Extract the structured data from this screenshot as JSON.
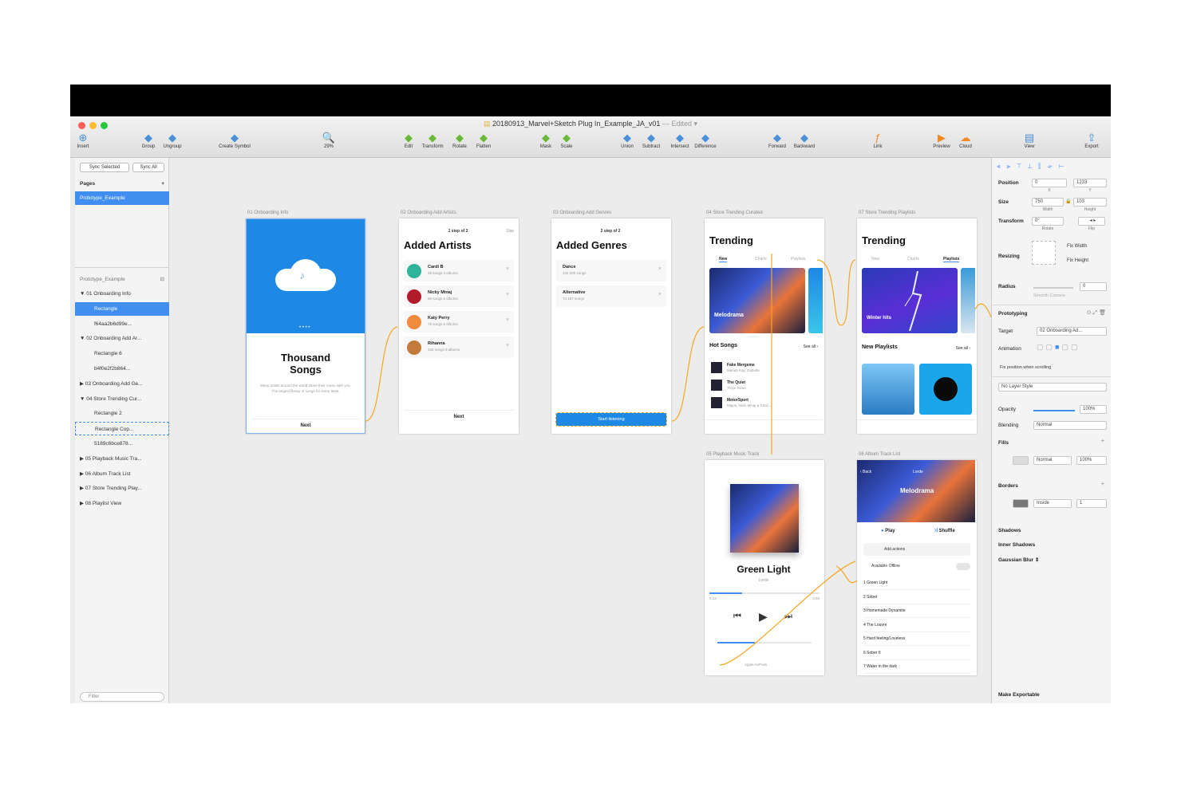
{
  "window": {
    "title": "20180913_Marvel+Sketch Plug In_Example_JA_v01",
    "edited": "— Edited ▾"
  },
  "toolbar": {
    "items": [
      {
        "label": "Insert",
        "icon": "plus-icon"
      },
      {
        "label": "Group",
        "icon": "group-icon"
      },
      {
        "label": "Ungroup",
        "icon": "ungroup-icon"
      },
      {
        "label": "Create Symbol",
        "icon": "symbol-icon"
      },
      {
        "label": "29%",
        "icon": "zoom-icon"
      },
      {
        "label": "Edit",
        "icon": "edit-icon"
      },
      {
        "label": "Transform",
        "icon": "transform-icon"
      },
      {
        "label": "Rotate",
        "icon": "rotate-icon"
      },
      {
        "label": "Flatten",
        "icon": "flatten-icon"
      },
      {
        "label": "Mask",
        "icon": "mask-icon"
      },
      {
        "label": "Scale",
        "icon": "scale-icon"
      },
      {
        "label": "Union",
        "icon": "union-icon"
      },
      {
        "label": "Subtract",
        "icon": "subtract-icon"
      },
      {
        "label": "Intersect",
        "icon": "intersect-icon"
      },
      {
        "label": "Difference",
        "icon": "difference-icon"
      },
      {
        "label": "Forward",
        "icon": "forward-icon"
      },
      {
        "label": "Backward",
        "icon": "backward-icon"
      },
      {
        "label": "Link",
        "icon": "link-icon"
      },
      {
        "label": "Preview",
        "icon": "preview-icon"
      },
      {
        "label": "Cloud",
        "icon": "cloud-icon"
      },
      {
        "label": "View",
        "icon": "view-icon"
      },
      {
        "label": "Export",
        "icon": "export-icon"
      }
    ]
  },
  "left": {
    "sync_selected": "Sync Selected",
    "sync_all": "Sync All",
    "pages_label": "Pages",
    "page_selected": "Prototype_Example",
    "layers_header": "Prototype_Example",
    "layers": [
      {
        "label": "▼ 01 Onboarding Info",
        "state": ""
      },
      {
        "label": "Rectangle",
        "state": "sel",
        "indent": 1
      },
      {
        "label": "f64aa2b6d99e...",
        "state": "",
        "indent": 1
      },
      {
        "label": "▼ 02 Onboarding Add Ar...",
        "state": ""
      },
      {
        "label": "Rectangle 6",
        "state": "",
        "indent": 1
      },
      {
        "label": "b4f0e2f2b864...",
        "state": "",
        "indent": 1
      },
      {
        "label": "▶ 03 Onboarding Add Ge...",
        "state": ""
      },
      {
        "label": "▼ 04 Store Trending Cur...",
        "state": ""
      },
      {
        "label": "Rectangle 2",
        "state": "",
        "indent": 1
      },
      {
        "label": "Rectangle Cop...",
        "state": "hl",
        "indent": 1
      },
      {
        "label": "5189c6bce878...",
        "state": "",
        "indent": 1
      },
      {
        "label": "▶ 05 Playback Music Tra...",
        "state": ""
      },
      {
        "label": "▶ 06 Album Track List",
        "state": ""
      },
      {
        "label": "▶ 07 Store Trending Play...",
        "state": ""
      },
      {
        "label": "▶ 08 Playlist View",
        "state": ""
      }
    ],
    "filter": "Filter"
  },
  "right": {
    "position_label": "Position",
    "x": "0",
    "y": "1233",
    "x_label": "X",
    "y_label": "Y",
    "size_label": "Size",
    "w": "750",
    "h": "103",
    "w_label": "Width",
    "h_label": "Height",
    "transform_label": "Transform",
    "rotate": "0°",
    "rotate_label": "Rotate",
    "flip_label": "Flip",
    "resizing_label": "Resizing",
    "fix_width": "Fix Width",
    "fix_height": "Fix Height",
    "radius_label": "Radius",
    "radius": "0",
    "smooth": "Smooth Corners",
    "prototyping_label": "Prototyping",
    "target_label": "Target",
    "target": "02 Onboarding Ad...",
    "animation_label": "Animation",
    "fix_scroll": "Fix position when scrolling",
    "layer_style": "No Layer Style",
    "opacity_label": "Opacity",
    "opacity": "100%",
    "opacity_value": 1.0,
    "blending_label": "Blending",
    "blending": "Normal",
    "fills_label": "Fills",
    "fill_blend": "Normal",
    "fill_opacity": "100%",
    "fill_sub": [
      "Fill",
      "Blending",
      "Opacity"
    ],
    "borders_label": "Borders",
    "border_pos": "Inside",
    "border_thick": "1",
    "border_sub": [
      "Color",
      "Position",
      "Thickness"
    ],
    "shadows": "Shadows",
    "inner_shadows": "Inner Shadows",
    "gaussian": "Gaussian Blur ⇕",
    "exportable": "Make Exportable"
  },
  "artboards": {
    "a1": {
      "label": "01 Onboarding Info",
      "title": "Thousand Songs",
      "body": "Many artists around the world share their music with you. The largest library of songs for every taste.",
      "btn": "Next"
    },
    "a2": {
      "label": "02 Onboarding Add Artists",
      "step": "1 step of 2",
      "skip": "Skip",
      "title": "Added Artists",
      "btn": "Next",
      "items": [
        {
          "name": "Cardi B",
          "sub": "38 songs 3 albums",
          "color": "#2fb39a"
        },
        {
          "name": "Nicky Minaj",
          "sub": "88 songs 6 albums",
          "color": "#b21c2a"
        },
        {
          "name": "Katy Perry",
          "sub": "75 songs 6 albums",
          "color": "#f08a3c"
        },
        {
          "name": "Rihanna",
          "sub": "102 songs 8 albums",
          "color": "#c47a3a"
        }
      ]
    },
    "a3": {
      "label": "03 Onboarding Add Genres",
      "step": "2 step of 2",
      "title": "Added Genres",
      "btn": "Start listening",
      "items": [
        {
          "name": "Dance",
          "sub": "344 000 songs"
        },
        {
          "name": "Alternative",
          "sub": "74 187 songs"
        }
      ]
    },
    "a4": {
      "label": "04 Store Trending Curated",
      "title": "Trending",
      "tabs": [
        "New",
        "Charts",
        "Playlists"
      ],
      "card_title": "Melodrama",
      "section": "Hot Songs",
      "see_all": "See all ›",
      "songs": [
        {
          "name": "Fake Mergeme",
          "sub": "Mariah Kay, Gabutte"
        },
        {
          "name": "The Quiet",
          "sub": "Troye Sivan"
        },
        {
          "name": "MotorSport",
          "sub": "Migos, Nicki Minaj & Card..."
        }
      ]
    },
    "a5": {
      "label": "07 Store Trending Playlists",
      "title": "Trending",
      "tabs": [
        "New",
        "Charts",
        "Playlists"
      ],
      "card_title": "Winter hits",
      "section": "New Playlists",
      "see_all": "See all ›"
    },
    "a6": {
      "label": "05 Playback Music Track",
      "song": "Green Light",
      "artist": "Lorde",
      "t_start": "0:14",
      "t_end": "-3:50",
      "progress": 0.3,
      "volume": 0.4,
      "bottom": "Apple AirPods"
    },
    "a7": {
      "label": "06 Album Track List",
      "back": "‹ Back",
      "artist": "Lorde",
      "album": "Melodrama",
      "play": "Play",
      "shuffle": "Shuffle",
      "actions": "Add actions",
      "offline": "Available Offline",
      "tracks": [
        "1  Green Light",
        "2  Sober",
        "3  Homemade Dynamite",
        "4  The Louvre",
        "5  Hard feeling/Loveless",
        "6  Sober II",
        "7  Water in the dark"
      ]
    }
  },
  "colors": {
    "accent": "#3f8ef0",
    "link": "#f5a623",
    "onboarding_blue": "#1e88e5"
  }
}
